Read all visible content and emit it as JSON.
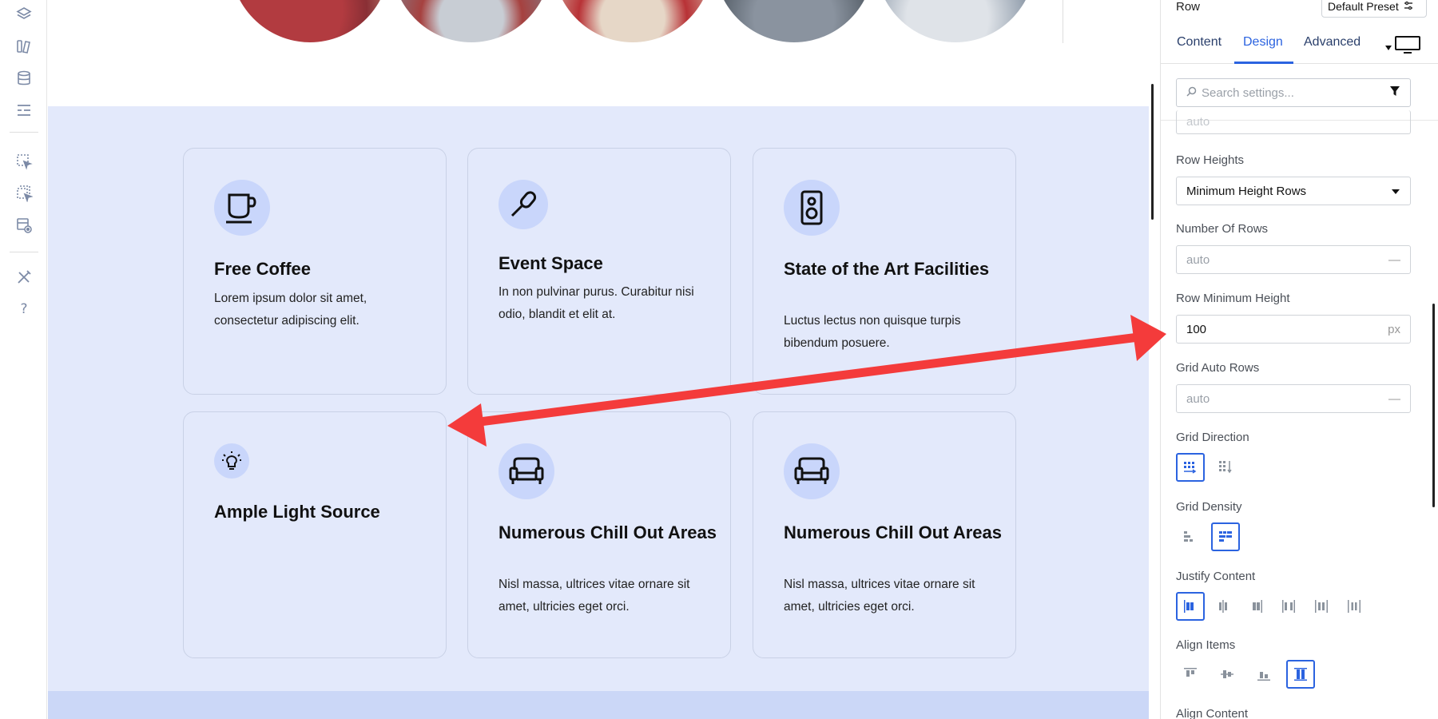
{
  "panel": {
    "title": "Row",
    "preset": "Default Preset",
    "tabs": [
      "Content",
      "Design",
      "Advanced"
    ],
    "active_tab": "Design",
    "search_placeholder": "Search settings...",
    "partial_top_value": "auto",
    "row_heights": {
      "label": "Row Heights",
      "value": "Minimum Height Rows"
    },
    "number_of_rows": {
      "label": "Number Of Rows",
      "placeholder": "auto",
      "unit": "—"
    },
    "row_min_height": {
      "label": "Row Minimum Height",
      "value": "100",
      "unit": "px"
    },
    "grid_auto_rows": {
      "label": "Grid Auto Rows",
      "placeholder": "auto",
      "unit": "—"
    },
    "grid_direction": {
      "label": "Grid Direction"
    },
    "grid_density": {
      "label": "Grid Density"
    },
    "justify_content": {
      "label": "Justify Content"
    },
    "align_items": {
      "label": "Align Items"
    },
    "align_content": {
      "label": "Align Content"
    }
  },
  "cards": [
    {
      "title": "Free Coffee",
      "text": "Lorem ipsum dolor sit amet, consectetur adipiscing elit.",
      "icon": "coffee-cup-icon"
    },
    {
      "title": "Event Space",
      "text": "In non pulvinar purus. Curabitur nisi odio, blandit et elit at.",
      "icon": "microphone-icon"
    },
    {
      "title": "State of the Art Facilities",
      "text": "Luctus lectus non quisque turpis bibendum posuere.",
      "icon": "speaker-icon"
    },
    {
      "title": "Ample Light Source",
      "text": "",
      "icon": "lightbulb-icon"
    },
    {
      "title": "Numerous Chill Out Areas",
      "text": "Nisl massa, ultrices vitae ornare sit amet, ultricies eget orci.",
      "icon": "sofa-icon"
    },
    {
      "title": "Numerous Chill Out Areas",
      "text": "Nisl massa, ultrices vitae ornare sit amet, ultricies eget orci.",
      "icon": "sofa-icon"
    }
  ],
  "colors": {
    "accent": "#2b63e0",
    "section_bg": "#e3e9fb",
    "icon_circle": "#c9d6fb",
    "annotation_arrow": "#f43b3b"
  }
}
